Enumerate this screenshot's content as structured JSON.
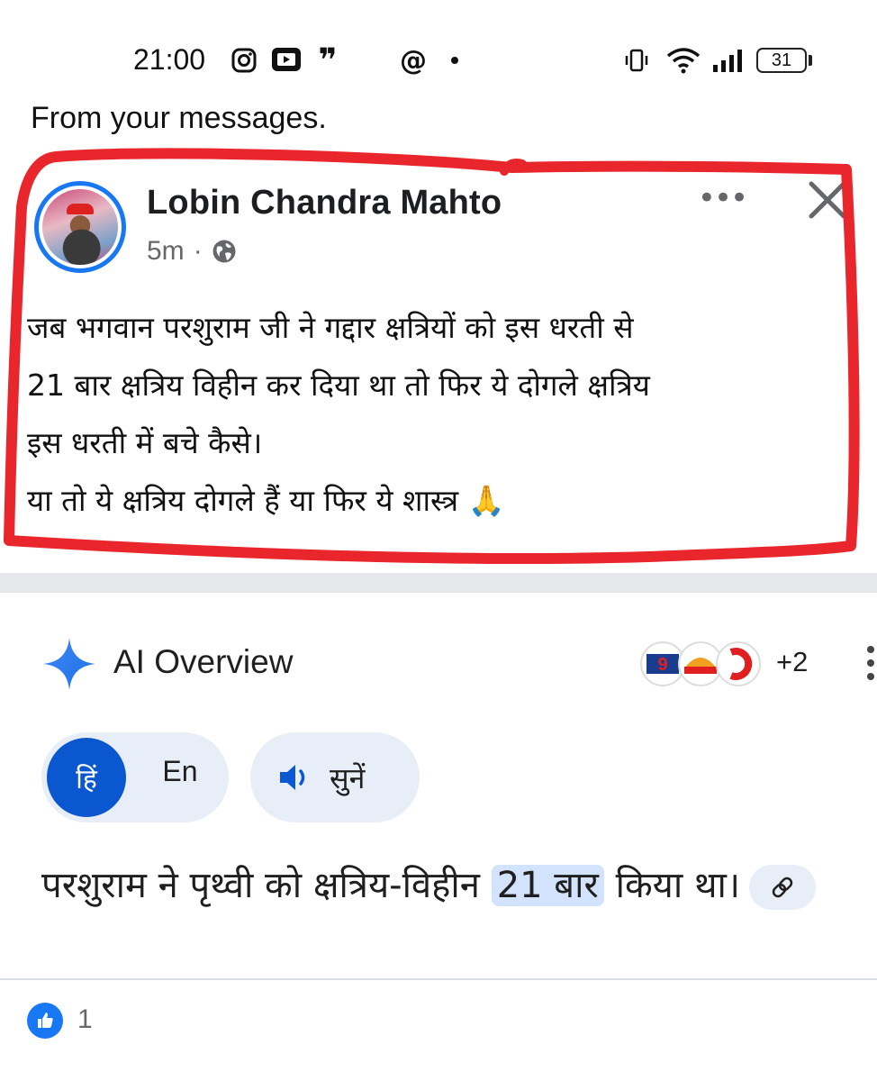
{
  "status_bar": {
    "time": "21:00",
    "left_icons": [
      "instagram-icon",
      "youtube-icon",
      "quote-icon",
      "threads-icon",
      "dot-icon"
    ],
    "right_icons": [
      "vibrate-icon",
      "wifi-icon",
      "signal-icon"
    ],
    "battery": "31"
  },
  "context_label": "From your messages.",
  "post": {
    "author": "Lobin Chandra Mahto",
    "time_ago": "5m",
    "separator": "·",
    "privacy_icon": "globe-icon",
    "more_label": "•••",
    "text": "जब भगवान परशुराम जी ने गद्दार क्षत्रियों को इस धरती से\n21 बार क्षत्रिय विहीन कर दिया था तो फिर ये दोगले क्षत्रिय\nइस धरती में बचे कैसे।\nया तो ये क्षत्रिय दोगले हैं या फिर ये शास्त्र 🙏",
    "annotation_color": "#e8262b"
  },
  "ai_overview": {
    "title": "AI Overview",
    "source_count": "+2",
    "lang_hi": "हिं",
    "lang_en": "En",
    "listen": "सुनें",
    "answer_before": "परशुराम ने पृथ्वी को क्षत्रिय-विहीन ",
    "answer_highlight": "21 बार",
    "answer_after": " किया था।",
    "accent": "#0b57d0"
  },
  "reactions": {
    "like_count": "1",
    "like_color": "#1877f2"
  }
}
